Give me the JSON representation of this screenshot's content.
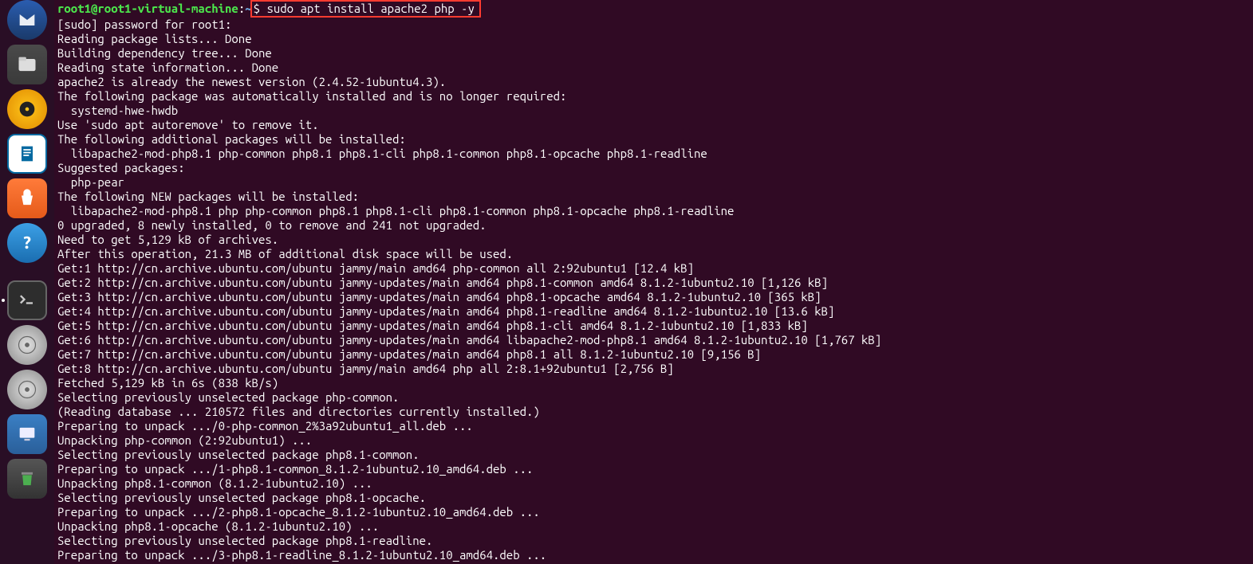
{
  "launcher": {
    "items": [
      {
        "name": "thunderbird",
        "label": "Thunderbird"
      },
      {
        "name": "files",
        "label": "Files"
      },
      {
        "name": "rhythmbox",
        "label": "Rhythmbox"
      },
      {
        "name": "libreoffice",
        "label": "LibreOffice Writer"
      },
      {
        "name": "software",
        "label": "Ubuntu Software"
      },
      {
        "name": "help",
        "label": "Help"
      },
      {
        "name": "terminal",
        "label": "Terminal",
        "active": true
      },
      {
        "name": "disk1",
        "label": "Disc"
      },
      {
        "name": "disk2",
        "label": "Disc"
      },
      {
        "name": "remmina",
        "label": "Remmina"
      },
      {
        "name": "trash",
        "label": "Trash"
      }
    ]
  },
  "prompt": {
    "user_host": "root1@root1-virtual-machine",
    "sep": ":",
    "cwd": "~",
    "dollar": "$ ",
    "command": "sudo apt install apache2 php -y"
  },
  "output": [
    "[sudo] password for root1:",
    "Reading package lists... Done",
    "Building dependency tree... Done",
    "Reading state information... Done",
    "apache2 is already the newest version (2.4.52-1ubuntu4.3).",
    "The following package was automatically installed and is no longer required:",
    "  systemd-hwe-hwdb",
    "Use 'sudo apt autoremove' to remove it.",
    "The following additional packages will be installed:",
    "  libapache2-mod-php8.1 php-common php8.1 php8.1-cli php8.1-common php8.1-opcache php8.1-readline",
    "Suggested packages:",
    "  php-pear",
    "The following NEW packages will be installed:",
    "  libapache2-mod-php8.1 php php-common php8.1 php8.1-cli php8.1-common php8.1-opcache php8.1-readline",
    "0 upgraded, 8 newly installed, 0 to remove and 241 not upgraded.",
    "Need to get 5,129 kB of archives.",
    "After this operation, 21.3 MB of additional disk space will be used.",
    "Get:1 http://cn.archive.ubuntu.com/ubuntu jammy/main amd64 php-common all 2:92ubuntu1 [12.4 kB]",
    "Get:2 http://cn.archive.ubuntu.com/ubuntu jammy-updates/main amd64 php8.1-common amd64 8.1.2-1ubuntu2.10 [1,126 kB]",
    "Get:3 http://cn.archive.ubuntu.com/ubuntu jammy-updates/main amd64 php8.1-opcache amd64 8.1.2-1ubuntu2.10 [365 kB]",
    "Get:4 http://cn.archive.ubuntu.com/ubuntu jammy-updates/main amd64 php8.1-readline amd64 8.1.2-1ubuntu2.10 [13.6 kB]",
    "Get:5 http://cn.archive.ubuntu.com/ubuntu jammy-updates/main amd64 php8.1-cli amd64 8.1.2-1ubuntu2.10 [1,833 kB]",
    "Get:6 http://cn.archive.ubuntu.com/ubuntu jammy-updates/main amd64 libapache2-mod-php8.1 amd64 8.1.2-1ubuntu2.10 [1,767 kB]",
    "Get:7 http://cn.archive.ubuntu.com/ubuntu jammy-updates/main amd64 php8.1 all 8.1.2-1ubuntu2.10 [9,156 B]",
    "Get:8 http://cn.archive.ubuntu.com/ubuntu jammy/main amd64 php all 2:8.1+92ubuntu1 [2,756 B]",
    "Fetched 5,129 kB in 6s (838 kB/s)",
    "Selecting previously unselected package php-common.",
    "(Reading database ... 210572 files and directories currently installed.)",
    "Preparing to unpack .../0-php-common_2%3a92ubuntu1_all.deb ...",
    "Unpacking php-common (2:92ubuntu1) ...",
    "Selecting previously unselected package php8.1-common.",
    "Preparing to unpack .../1-php8.1-common_8.1.2-1ubuntu2.10_amd64.deb ...",
    "Unpacking php8.1-common (8.1.2-1ubuntu2.10) ...",
    "Selecting previously unselected package php8.1-opcache.",
    "Preparing to unpack .../2-php8.1-opcache_8.1.2-1ubuntu2.10_amd64.deb ...",
    "Unpacking php8.1-opcache (8.1.2-1ubuntu2.10) ...",
    "Selecting previously unselected package php8.1-readline.",
    "Preparing to unpack .../3-php8.1-readline_8.1.2-1ubuntu2.10_amd64.deb ..."
  ]
}
